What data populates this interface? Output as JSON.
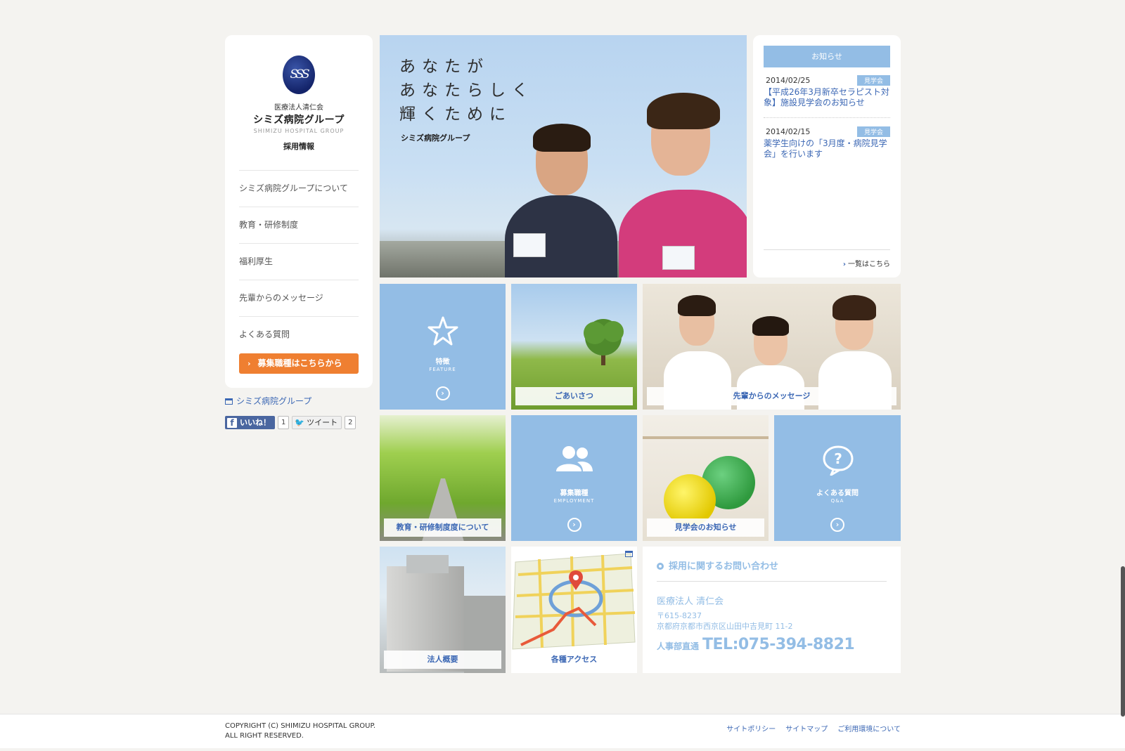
{
  "sidebar": {
    "logo_mark": "SSS",
    "org": "医療法人清仁会",
    "name": "シミズ病院グループ",
    "name_en": "SHIMIZU HOSPITAL GROUP",
    "sub": "採用情報",
    "nav": [
      {
        "label": "シミズ病院グループについて"
      },
      {
        "label": "教育・研修制度"
      },
      {
        "label": "福利厚生"
      },
      {
        "label": "先輩からのメッセージ"
      },
      {
        "label": "よくある質問"
      }
    ],
    "cta": "募集職種はこちらから"
  },
  "ext_link": "シミズ病院グループ",
  "social": {
    "like_label": "いいね！",
    "like_count": "1",
    "tweet_label": "ツイート",
    "tweet_count": "2"
  },
  "hero": {
    "line1": "あなたが",
    "line2": "あなたらしく",
    "line3": "輝くために",
    "signature": "シミズ病院グループ"
  },
  "news": {
    "heading": "お知らせ",
    "items": [
      {
        "date": "2014/02/25",
        "tag": "見学会",
        "text": "【平成26年3月新卒セラピスト対象】施設見学会のお知らせ"
      },
      {
        "date": "2014/02/15",
        "tag": "見学会",
        "text": "薬学生向けの「3月度・病院見学会」を行います"
      }
    ],
    "more": "一覧はこちら"
  },
  "tiles": {
    "feature_title": "特徴",
    "feature_sub": "FEATURE",
    "greeting": "ごあいさつ",
    "messages": "先輩からのメッセージ",
    "training": "教育・研修制度度について",
    "employment_title": "募集職種",
    "employment_sub": "EMPLOYMENT",
    "visit": "見学会のお知らせ",
    "faq_title": "よくある質問",
    "faq_sub": "Q&A",
    "overview": "法人概要",
    "access": "各種アクセス"
  },
  "contact": {
    "title": "採用に関するお問い合わせ",
    "org": "医療法人 清仁会",
    "zip": "〒615-8237",
    "address": "京都府京都市西京区山田中吉見町 11-2",
    "tel_label": "人事部直通",
    "tel": "TEL:075-394-8821"
  },
  "footer": {
    "copy1": "COPYRIGHT (C) SHIMIZU HOSPITAL GROUP.",
    "copy2": "ALL RIGHT RESERVED.",
    "links": [
      "サイトポリシー",
      "サイトマップ",
      "ご利用環境について"
    ]
  },
  "colors": {
    "accent": "#93bde5",
    "link": "#3b67b4",
    "cta": "#ef7f31",
    "background": "#f4f3f0"
  }
}
